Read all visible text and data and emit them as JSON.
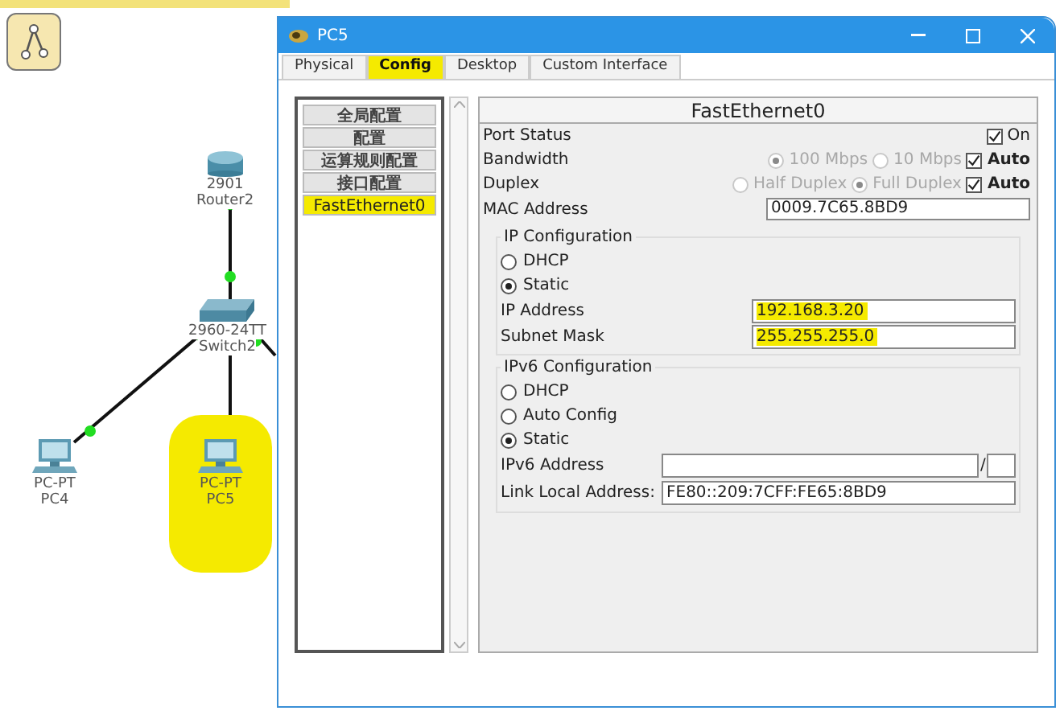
{
  "canvas": {
    "devices": [
      {
        "kind": "router",
        "model": "2901",
        "name": "Router2",
        "highlighted": false
      },
      {
        "kind": "switch",
        "model": "2960-24TT",
        "name": "Switch2",
        "highlighted": false
      },
      {
        "kind": "pc",
        "model": "PC-PT",
        "name": "PC4",
        "highlighted": false
      },
      {
        "kind": "pc",
        "model": "PC-PT",
        "name": "PC5",
        "highlighted": true
      }
    ]
  },
  "window": {
    "title": "PC5"
  },
  "tabs": [
    {
      "label": "Physical",
      "selected": false,
      "highlighted": false
    },
    {
      "label": "Config",
      "selected": true,
      "highlighted": true
    },
    {
      "label": "Desktop",
      "selected": false,
      "highlighted": false
    },
    {
      "label": "Custom Interface",
      "selected": false,
      "highlighted": false
    }
  ],
  "sidebar": {
    "items": [
      {
        "label": "全局配置",
        "selected": false,
        "highlighted": false
      },
      {
        "label": "配置",
        "selected": false,
        "highlighted": false
      },
      {
        "label": "运算规则配置",
        "selected": false,
        "highlighted": false
      },
      {
        "label": "接口配置",
        "selected": false,
        "highlighted": false
      },
      {
        "label": "FastEthernet0",
        "selected": true,
        "highlighted": true
      }
    ]
  },
  "interface": {
    "title": "FastEthernet0",
    "port_status": {
      "label": "Port Status",
      "on_label": "On",
      "checked": true
    },
    "bandwidth": {
      "label": "Bandwidth",
      "disabled": true,
      "options": [
        {
          "label": "100 Mbps",
          "selected": true
        },
        {
          "label": "10 Mbps",
          "selected": false
        }
      ],
      "auto_label": "Auto",
      "auto_checked": true
    },
    "duplex": {
      "label": "Duplex",
      "disabled": true,
      "options": [
        {
          "label": "Half Duplex",
          "selected": false
        },
        {
          "label": "Full Duplex",
          "selected": true
        }
      ],
      "auto_label": "Auto",
      "auto_checked": true
    },
    "mac": {
      "label": "MAC Address",
      "value": "0009.7C65.8BD9"
    },
    "ipv4": {
      "title": "IP Configuration",
      "modes": [
        {
          "label": "DHCP",
          "selected": false
        },
        {
          "label": "Static",
          "selected": true
        }
      ],
      "fields": [
        {
          "label": "IP Address",
          "value": "192.168.3.20",
          "highlighted": true
        },
        {
          "label": "Subnet Mask",
          "value": "255.255.255.0",
          "highlighted": true
        }
      ]
    },
    "ipv6": {
      "title": "IPv6 Configuration",
      "modes": [
        {
          "label": "DHCP",
          "selected": false
        },
        {
          "label": "Auto Config",
          "selected": false
        },
        {
          "label": "Static",
          "selected": true
        }
      ],
      "address": {
        "label": "IPv6 Address",
        "separator": "/"
      },
      "link_local": {
        "label": "Link Local Address:",
        "value": "FE80::209:7CFF:FE65:8BD9"
      }
    }
  }
}
